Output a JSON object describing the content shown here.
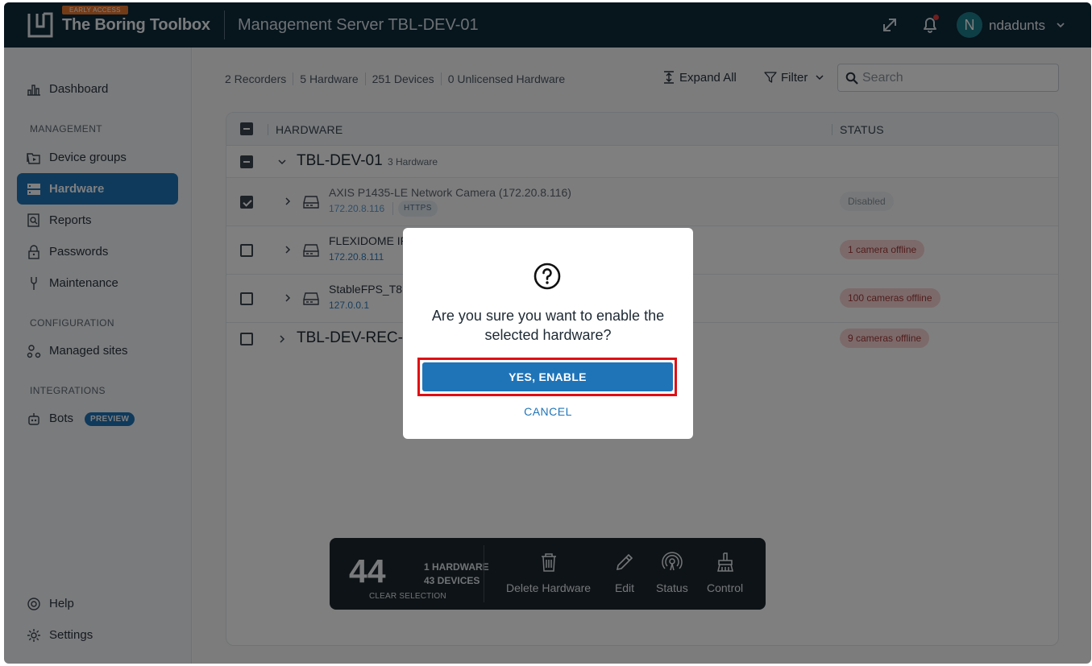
{
  "topbar": {
    "early_access": "EARLY ACCESS",
    "brand": "The Boring Toolbox",
    "server_title": "Management Server TBL-DEV-01",
    "user_initial": "N",
    "username": "ndadunts"
  },
  "sidebar": {
    "dashboard": "Dashboard",
    "section_management": "MANAGEMENT",
    "device_groups": "Device groups",
    "hardware": "Hardware",
    "reports": "Reports",
    "passwords": "Passwords",
    "maintenance": "Maintenance",
    "section_configuration": "CONFIGURATION",
    "managed_sites": "Managed sites",
    "section_integrations": "INTEGRATIONS",
    "bots": "Bots",
    "bots_badge": "PREVIEW",
    "help": "Help",
    "settings": "Settings"
  },
  "summary": {
    "recorders": "2 Recorders",
    "hardware": "5 Hardware",
    "devices": "251 Devices",
    "unlicensed": "0 Unlicensed Hardware"
  },
  "toolbar": {
    "expand_all": "Expand All",
    "filter": "Filter",
    "search_placeholder": "Search"
  },
  "table": {
    "col_hardware": "HARDWARE",
    "col_status": "STATUS",
    "groups": [
      {
        "name": "TBL-DEV-01",
        "count": "3 Hardware",
        "items": [
          {
            "name": "AXIS P1435-LE Network Camera (172.20.8.116)",
            "ip": "172.20.8.116",
            "protocol": "HTTPS",
            "status": "Disabled"
          },
          {
            "name": "FLEXIDOME IP",
            "ip": "172.20.8.111",
            "status": "1 camera offline"
          },
          {
            "name": "StableFPS_T8",
            "ip": "127.0.0.1",
            "status": "100 cameras offline"
          }
        ]
      },
      {
        "name": "TBL-DEV-REC-0",
        "status": "9 cameras offline"
      }
    ]
  },
  "selection": {
    "count": "44",
    "hardware": "1 HARDWARE",
    "devices": "43 DEVICES",
    "clear": "CLEAR SELECTION",
    "actions": [
      "Delete Hardware",
      "Edit",
      "Status",
      "Control"
    ]
  },
  "dialog": {
    "question": "Are you sure you want to enable the selected hardware?",
    "confirm": "YES, ENABLE",
    "cancel": "CANCEL"
  },
  "colors": {
    "topbar": "#0f2b3a",
    "accent": "#1f74b8",
    "highlight": "#e00d14"
  }
}
